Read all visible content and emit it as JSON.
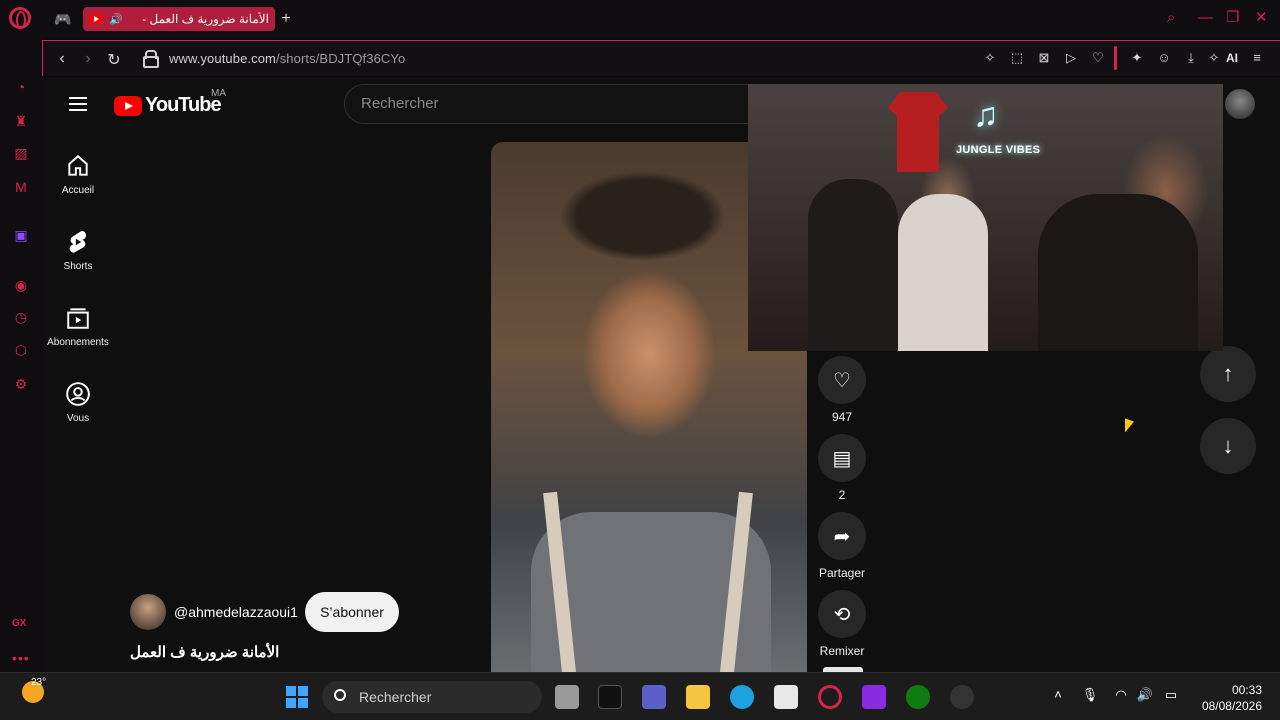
{
  "browser": {
    "tab_title": "الأمانة ضرورية ف العمل -",
    "url_host": "www.youtube.com",
    "url_path": "/shorts/BDJTQf36CYo",
    "ai_label": "AI",
    "accent_color": "#d3244b",
    "gx_label": "GX"
  },
  "youtube": {
    "logo_text": "YouTube",
    "country_code": "MA",
    "search_placeholder": "Rechercher",
    "guide": [
      {
        "label": "Accueil",
        "icon": "home-icon"
      },
      {
        "label": "Shorts",
        "icon": "shorts-icon"
      },
      {
        "label": "Abonnements",
        "icon": "subscriptions-icon"
      },
      {
        "label": "Vous",
        "icon": "account-icon"
      }
    ],
    "actions": {
      "like_count": "947",
      "comment_count": "2",
      "share_label": "Partager",
      "remix_label": "Remixer"
    },
    "channel": {
      "handle": "@ahmedelazzaoui1",
      "subscribe_label": "S’abonner"
    },
    "short_title": "الأمانة ضرورية ف العمل"
  },
  "pip": {
    "neon_text": "JUNGLE VIBES"
  },
  "taskbar": {
    "temperature": "23°",
    "search_label": "Rechercher",
    "time": "00:33",
    "date": "08/08/2026"
  }
}
